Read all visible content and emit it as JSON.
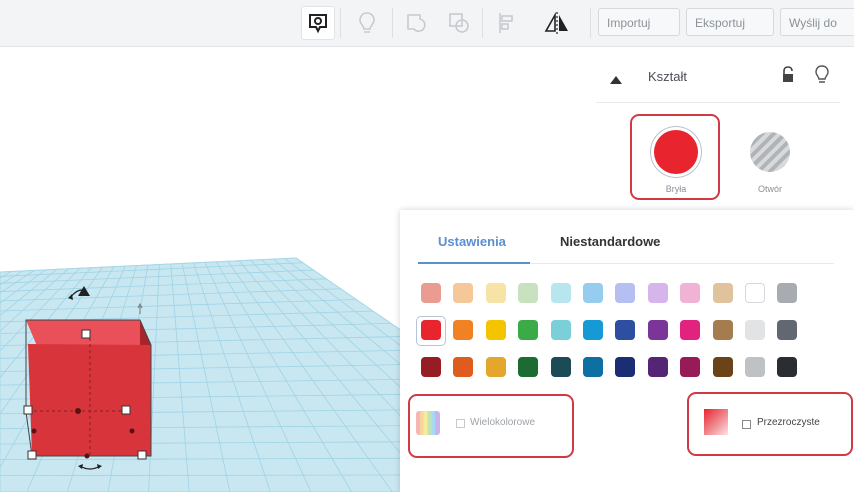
{
  "toolbar": {
    "icons": [
      "note-icon",
      "bulb-icon",
      "group-icon",
      "ungroup-icon",
      "align-icon",
      "mirror-icon"
    ],
    "import_label": "Importuj",
    "export_label": "Eksportuj",
    "send_label": "Wyślij do"
  },
  "inspector": {
    "title": "Kształt",
    "solid_label": "Bryła",
    "hole_label": "Otwór",
    "solid_color": "#e8252f"
  },
  "color_panel": {
    "tabs": [
      "Ustawienia",
      "Niestandardowe"
    ],
    "active_tab": "Ustawienia",
    "swatches": [
      [
        "#ea9c92",
        "#f5c799",
        "#f7e3a6",
        "#c8e2c0",
        "#b8e6ef",
        "#96cdee",
        "#b5bff1",
        "#d5b5eb",
        "#f0b2d5",
        "#e0c39c",
        "#ffffff",
        "#a8acb1"
      ],
      [
        "#e8252f",
        "#f08223",
        "#f5c400",
        "#3aab47",
        "#7acfd8",
        "#169ad6",
        "#2e4ea1",
        "#7b3599",
        "#e1227e",
        "#a47c4f",
        "#e1e3e5",
        "#616871"
      ],
      [
        "#961d23",
        "#de5c1d",
        "#e3a72c",
        "#1c6b33",
        "#1b4b54",
        "#0e6fa3",
        "#1b2d73",
        "#542575",
        "#971b57",
        "#6b4318",
        "#bfc2c5",
        "#2a2e33"
      ]
    ],
    "selected_color": "#e8252f",
    "multicolor_label": "Wielokolorowe",
    "transparent_label": "Przezroczyste"
  },
  "colors": {
    "accent": "#5a8fd0",
    "highlight_box": "#cf3b44",
    "grid": "#c6e7f1",
    "cube": "#d8343b"
  }
}
